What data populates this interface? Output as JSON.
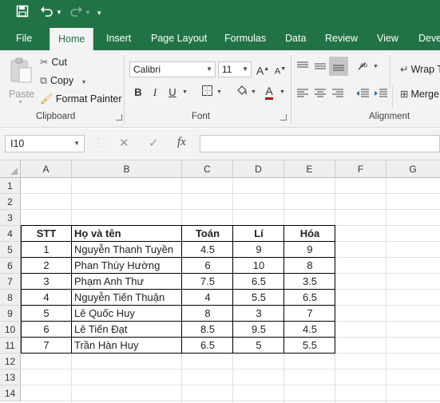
{
  "quick_access": {
    "save_icon": "save-icon",
    "undo_icon": "undo-icon",
    "redo_icon": "redo-icon",
    "customize_icon": "customize-qat-icon"
  },
  "tabs": [
    {
      "label": "File"
    },
    {
      "label": "Home"
    },
    {
      "label": "Insert"
    },
    {
      "label": "Page Layout"
    },
    {
      "label": "Formulas"
    },
    {
      "label": "Data"
    },
    {
      "label": "Review"
    },
    {
      "label": "View"
    },
    {
      "label": "Deve"
    }
  ],
  "ribbon": {
    "clipboard": {
      "paste": "Paste",
      "cut": "Cut",
      "copy": "Copy",
      "format_painter": "Format Painter",
      "group_label": "Clipboard"
    },
    "font": {
      "font_name": "Calibri",
      "font_size": "11",
      "bold": "B",
      "italic": "I",
      "underline": "U",
      "group_label": "Font",
      "grow": "A",
      "shrink": "A",
      "font_color_glyph": "A"
    },
    "alignment": {
      "wrap_text": "Wrap T",
      "merge": "Merge",
      "group_label": "Alignment"
    }
  },
  "formula_bar": {
    "name_box": "I10",
    "cancel": "✕",
    "enter": "✓",
    "fx": "fx",
    "value": ""
  },
  "columns": [
    "A",
    "B",
    "C",
    "D",
    "E",
    "F",
    "G"
  ],
  "rows": [
    "1",
    "2",
    "3",
    "4",
    "5",
    "6",
    "7",
    "8",
    "9",
    "10",
    "11",
    "12",
    "13",
    "14"
  ],
  "table": {
    "headers": [
      "STT",
      "Họ và tên",
      "Toán",
      "Lí",
      "Hóa"
    ],
    "records": [
      [
        "1",
        "Nguyễn Thanh Tuyền",
        "4.5",
        "9",
        "9"
      ],
      [
        "2",
        "Phan Thúy Hường",
        "6",
        "10",
        "8"
      ],
      [
        "3",
        "Phạm Anh Thư",
        "7.5",
        "6.5",
        "3.5"
      ],
      [
        "4",
        "Nguyễn Tiến Thuận",
        "4",
        "5.5",
        "6.5"
      ],
      [
        "5",
        "Lê Quốc Huy",
        "8",
        "3",
        "7"
      ],
      [
        "6",
        "Lê Tiến Đạt",
        "8.5",
        "9.5",
        "4.5"
      ],
      [
        "7",
        "Trần Hàn Huy",
        "6.5",
        "5",
        "5.5"
      ]
    ]
  },
  "colors": {
    "brand": "#217346",
    "ribbon_bg": "#f3f3f3"
  }
}
